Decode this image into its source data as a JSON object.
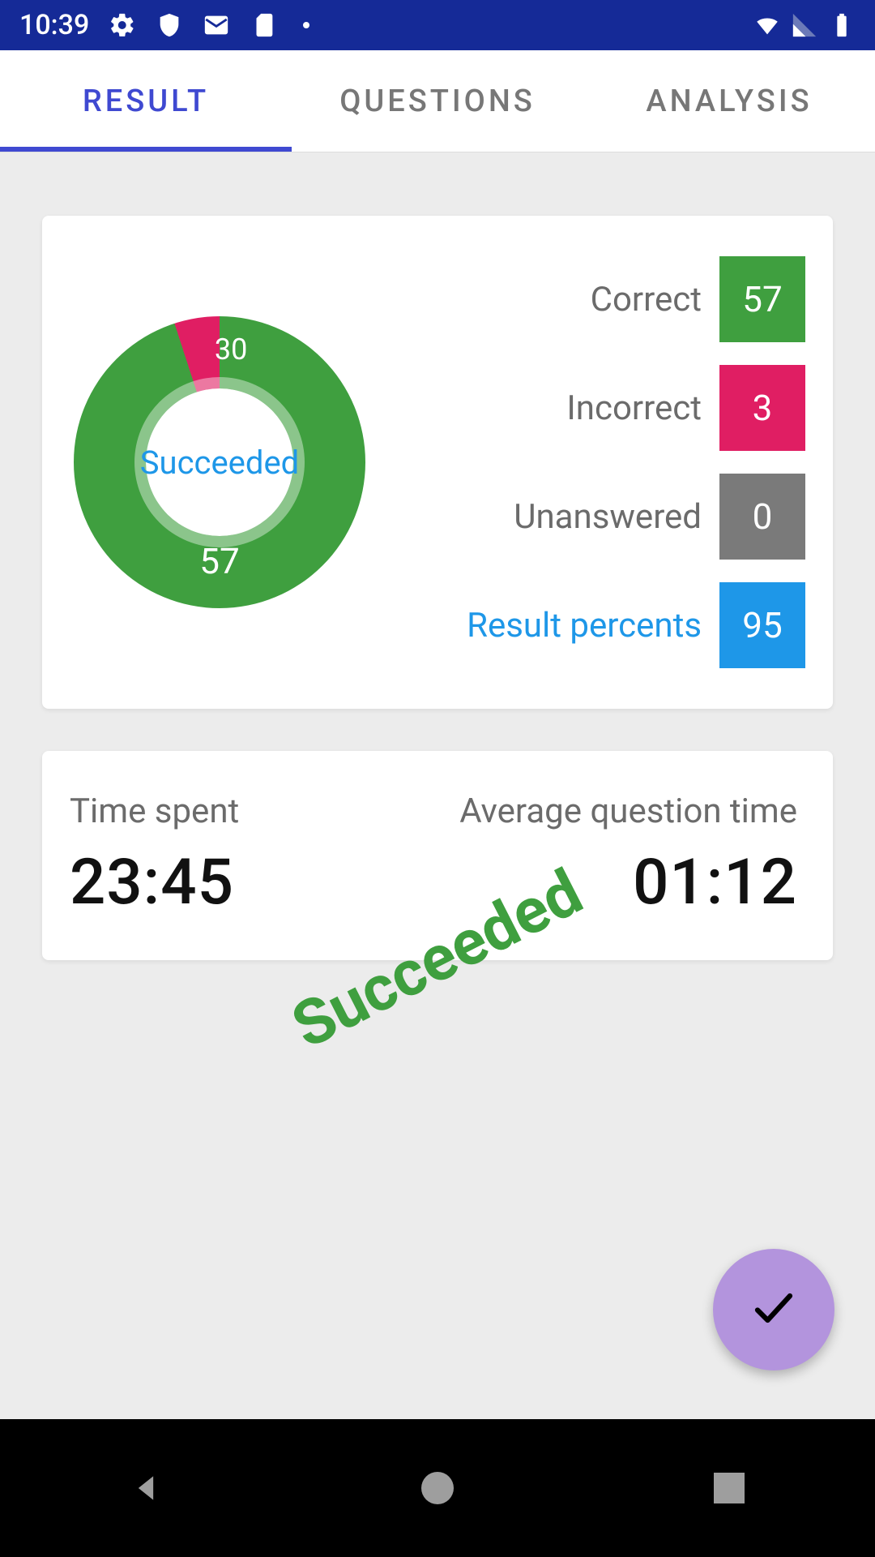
{
  "status": {
    "time": "10:39"
  },
  "tabs": {
    "items": [
      "RESULT",
      "QUESTIONS",
      "ANALYSIS"
    ],
    "active": 0
  },
  "chart_data": {
    "type": "pie",
    "title": "",
    "center_label": "Succeeded",
    "categories": [
      "Correct",
      "Incorrect",
      "Unanswered"
    ],
    "values": [
      57,
      3,
      0
    ],
    "colors": [
      "#3F9F3F",
      "#E01E63",
      "#7A7A7A"
    ],
    "value_labels": {
      "correct": "57",
      "incorrect": "30"
    }
  },
  "stats": {
    "correct": {
      "label": "Correct",
      "value": "57"
    },
    "incorrect": {
      "label": "Incorrect",
      "value": "3"
    },
    "unanswered": {
      "label": "Unanswered",
      "value": "0"
    },
    "percent": {
      "label": "Result percents",
      "value": "95"
    }
  },
  "time": {
    "spent": {
      "label": "Time spent",
      "value": "23:45"
    },
    "average": {
      "label": "Average question time",
      "value": "01:12"
    }
  },
  "stamp": "Succeeded",
  "colors": {
    "green": "#3F9F3F",
    "pink": "#E01E63",
    "gray": "#7A7A7A",
    "blue": "#1E97E8"
  }
}
